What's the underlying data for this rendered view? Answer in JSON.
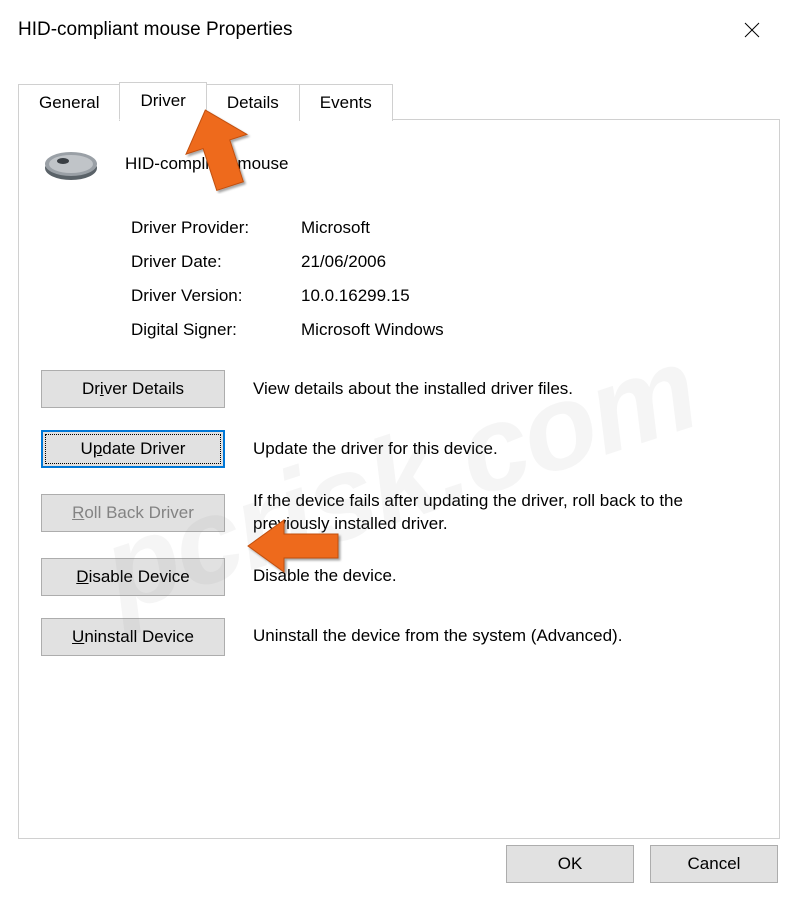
{
  "window": {
    "title": "HID-compliant mouse Properties"
  },
  "tabs": {
    "general": "General",
    "driver": "Driver",
    "details": "Details",
    "events": "Events"
  },
  "device": {
    "name": "HID-compliant mouse"
  },
  "info": {
    "provider_label": "Driver Provider:",
    "provider_value": "Microsoft",
    "date_label": "Driver Date:",
    "date_value": "21/06/2006",
    "version_label": "Driver Version:",
    "version_value": "10.0.16299.15",
    "signer_label": "Digital Signer:",
    "signer_value": "Microsoft Windows"
  },
  "buttons": {
    "driver_details": "Driver Details",
    "driver_details_desc": "View details about the installed driver files.",
    "update_driver": "Update Driver",
    "update_driver_desc": "Update the driver for this device.",
    "roll_back": "Roll Back Driver",
    "roll_back_desc": "If the device fails after updating the driver, roll back to the previously installed driver.",
    "disable": "Disable Device",
    "disable_desc": "Disable the device.",
    "uninstall": "Uninstall Device",
    "uninstall_desc": "Uninstall the device from the system (Advanced)."
  },
  "dialog": {
    "ok": "OK",
    "cancel": "Cancel"
  },
  "watermark": "pcrisk.com"
}
